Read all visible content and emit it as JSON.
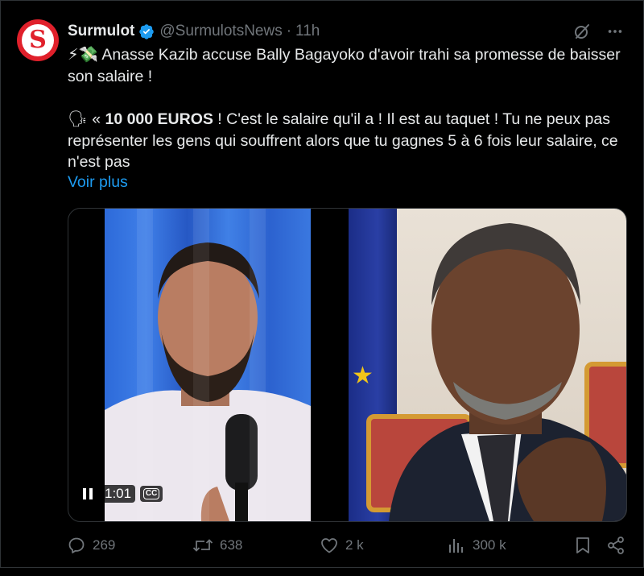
{
  "tweet": {
    "author_name": "Surmulot",
    "handle": "@SurmulotsNews",
    "separator": "·",
    "time": "11h",
    "avatar_letter": "S",
    "headline_emoji": "⚡💸",
    "headline": "Anasse Kazib accuse Bally Bagayoko d'avoir trahi sa promesse de baisser son salaire !",
    "quote_emoji": "🗣",
    "quote_open": "«",
    "quote_bold": "10 000 EUROS",
    "quote_rest": "! C'est le salaire qu'il a ! Il est au taquet ! Tu ne peux pas représenter les gens qui souffrent alors que tu gagnes 5 à 6 fois leur salaire, ce n'est pas",
    "show_more": "Voir plus"
  },
  "video": {
    "timecode": "1:01",
    "cc_label": "CC"
  },
  "actions": {
    "replies": "269",
    "reposts": "638",
    "likes": "2 k",
    "views": "300 k"
  },
  "colors": {
    "background": "#000000",
    "text": "#e7e9ea",
    "muted": "#71767b",
    "link": "#1d9bf0",
    "verified": "#1d9bf0",
    "avatar_red": "#e0202b"
  },
  "icons": {
    "verified": "verified-badge-icon",
    "grok": "grok-icon",
    "more": "more-icon",
    "reply": "reply-icon",
    "repost": "repost-icon",
    "like": "heart-icon",
    "views": "views-icon",
    "bookmark": "bookmark-icon",
    "share": "share-icon",
    "pause": "pause-icon",
    "captions": "captions-icon"
  }
}
